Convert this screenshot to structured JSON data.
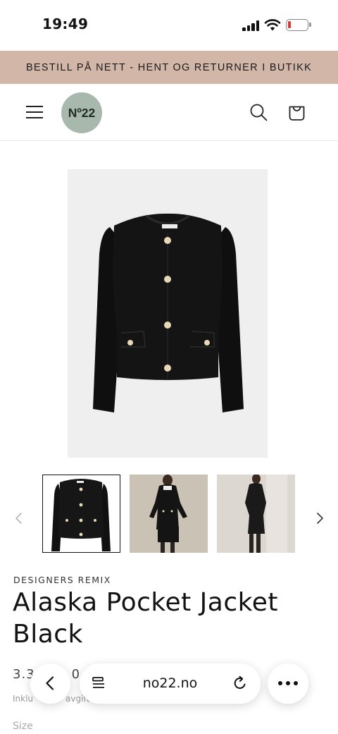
{
  "status_bar": {
    "time": "19:49"
  },
  "announcement": {
    "text": "BESTILL PÅ NETT - HENT OG RETURNER I BUTIKK"
  },
  "header": {
    "logo_text": "Nº22",
    "logo_color": "#a8b8ac",
    "icons": [
      "menu-icon",
      "search-icon",
      "cart-icon"
    ]
  },
  "product": {
    "vendor": "DESIGNERS REMIX",
    "title": "Alaska Pocket Jacket Black",
    "price_visible": "3.3",
    "price_tail": "0",
    "tax_note": "Inklu",
    "tax_note_tail": "avgift",
    "size_label": "Size",
    "image_count": 3
  },
  "browser": {
    "url": "no22.no",
    "buttons": [
      "back-icon",
      "tabs-icon",
      "reload-icon",
      "more-icon"
    ]
  },
  "colors": {
    "announcement_bg": "#d2b6a8",
    "text": "#121212",
    "battery_low": "#e3342f"
  }
}
